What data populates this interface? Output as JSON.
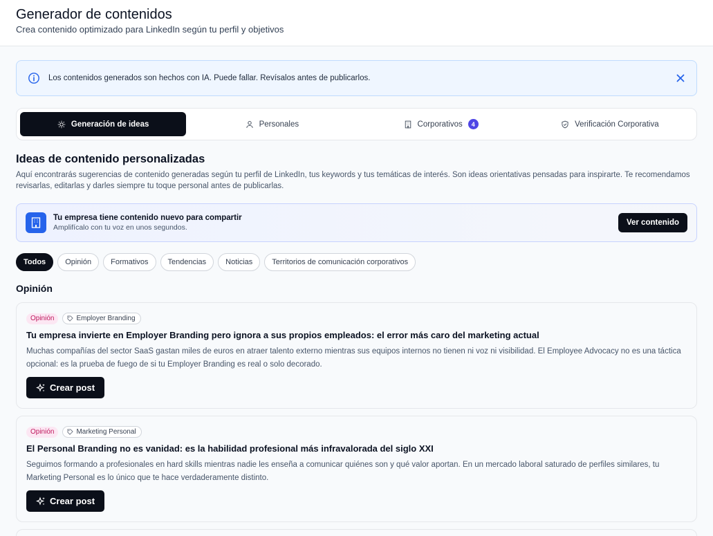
{
  "header": {
    "title": "Generador de contenidos",
    "subtitle": "Crea contenido optimizado para LinkedIn según tu perfil y objetivos"
  },
  "alert": {
    "text": "Los contenidos generados son hechos con IA. Puede fallar. Revísalos antes de publicarlos."
  },
  "tabs": [
    {
      "label": "Generación de ideas",
      "icon": "lightbulb-icon"
    },
    {
      "label": "Personales",
      "icon": "user-icon"
    },
    {
      "label": "Corporativos",
      "icon": "building-icon",
      "count": "4"
    },
    {
      "label": "Verificación Corporativa",
      "icon": "shield-check-icon"
    }
  ],
  "section": {
    "title": "Ideas de contenido personalizadas",
    "description": "Aquí encontrarás sugerencias de contenido generadas según tu perfil de LinkedIn, tus keywords y tus temáticas de interés. Son ideas orientativas pensadas para inspirarte. Te recomendamos revisarlas, editarlas y darles siempre tu toque personal antes de publicarlas."
  },
  "promo": {
    "title": "Tu empresa tiene contenido nuevo para compartir",
    "subtitle": "Amplifícalo con tu voz en unos segundos.",
    "button": "Ver contenido"
  },
  "filters": [
    "Todos",
    "Opinión",
    "Formativos",
    "Tendencias",
    "Noticias",
    "Territorios de comunicación corporativos"
  ],
  "group_title": "Opinión",
  "cards": [
    {
      "type": "Opinión",
      "keyword": "Employer Branding",
      "title": "Tu empresa invierte en Employer Branding pero ignora a sus propios empleados: el error más caro del marketing actual",
      "body": "Muchas compañías del sector SaaS gastan miles de euros en atraer talento externo mientras sus equipos internos no tienen ni voz ni visibilidad. El Employee Advocacy no es una táctica opcional: es la prueba de fuego de si tu Employer Branding es real o solo decorado.",
      "button": "Crear post"
    },
    {
      "type": "Opinión",
      "keyword": "Marketing Personal",
      "title": "El Personal Branding no es vanidad: es la habilidad profesional más infravalorada del siglo XXI",
      "body": "Seguimos formando a profesionales en hard skills mientras nadie les enseña a comunicar quiénes son y qué valor aportan. En un mercado laboral saturado de perfiles similares, tu Marketing Personal es lo único que te hace verdaderamente distinto.",
      "button": "Crear post"
    }
  ]
}
